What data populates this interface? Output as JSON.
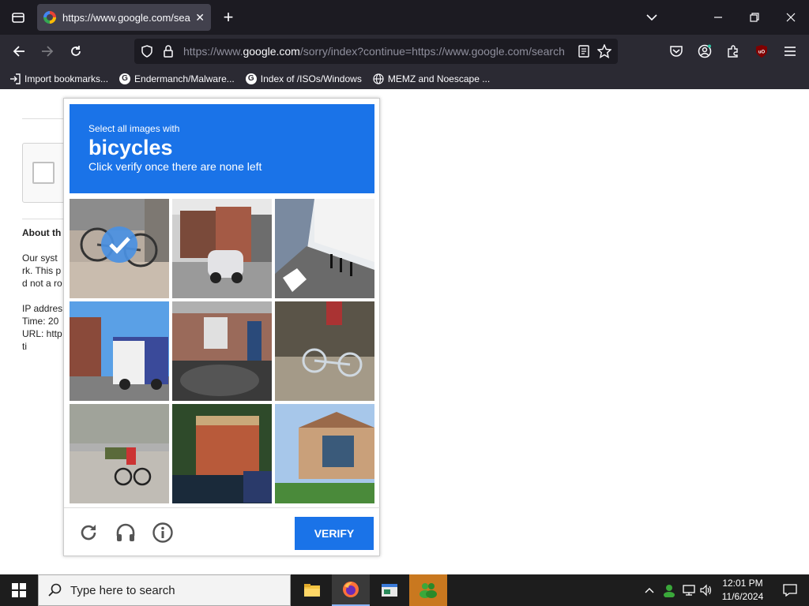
{
  "browser": {
    "tab_title": "https://www.google.com/searc",
    "url_prefix": "https://www.",
    "url_domain": "google.com",
    "url_rest": "/sorry/index?continue=https://www.google.com/search",
    "bookmarks": [
      {
        "label": "Import bookmarks...",
        "icon": "import-icon"
      },
      {
        "label": "Endermanch/Malware...",
        "icon": "google-icon"
      },
      {
        "label": "Index of /ISOs/Windows",
        "icon": "google-icon"
      },
      {
        "label": "MEMZ and Noescape ...",
        "icon": "globe-icon"
      }
    ]
  },
  "background_page": {
    "about_heading": "About th",
    "line1": "Our syst",
    "line2": "rk. This p",
    "line3": "d not a ro",
    "ip": "IP addres",
    "time": "Time: 20",
    "url": "URL: http",
    "ti": "ti"
  },
  "captcha": {
    "instruction": "Select all images with",
    "target": "bicycles",
    "subtext": "Click verify once there are none left",
    "verify_label": "VERIFY",
    "tiles": [
      {
        "selected": true
      },
      {
        "selected": false
      },
      {
        "selected": false
      },
      {
        "selected": false
      },
      {
        "selected": false
      },
      {
        "selected": false
      },
      {
        "selected": false
      },
      {
        "selected": false
      },
      {
        "selected": false
      }
    ]
  },
  "taskbar": {
    "search_placeholder": "Type here to search",
    "time": "12:01 PM",
    "date": "11/6/2024"
  },
  "colors": {
    "accent": "#1a73e8",
    "browser_dark": "#1c1b22",
    "browser_mid": "#2b2a33"
  }
}
